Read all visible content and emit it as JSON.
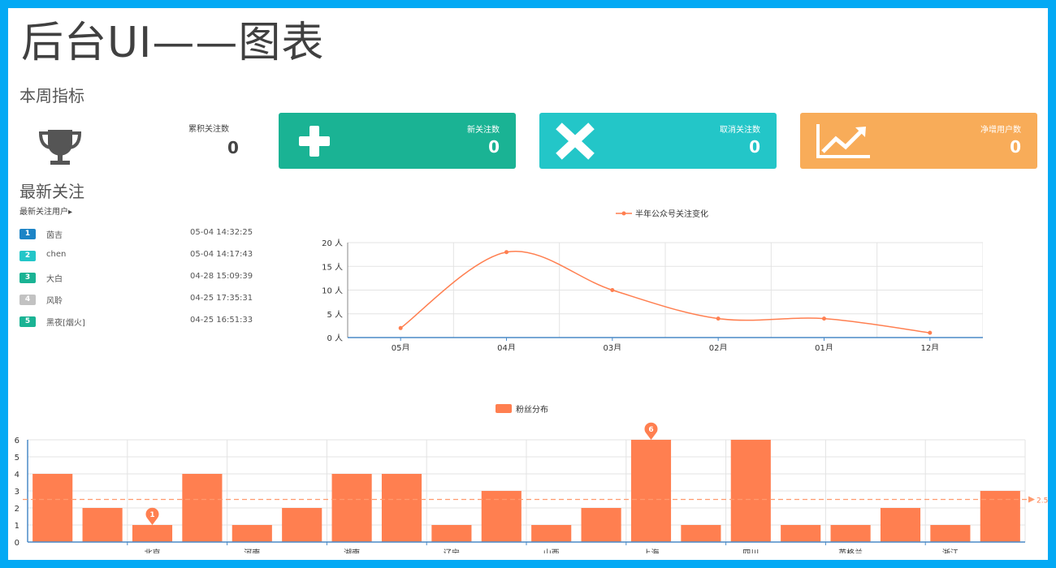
{
  "page": {
    "title": "后台UI——图表"
  },
  "weekly": {
    "title": "本周指标",
    "total": {
      "label": "累积关注数",
      "value": "0",
      "icon": "trophy-icon"
    },
    "cards": [
      {
        "id": "new",
        "label": "新关注数",
        "value": "0",
        "icon": "plus-icon",
        "color": "#1ab394"
      },
      {
        "id": "cancel",
        "label": "取消关注数",
        "value": "0",
        "icon": "cross-icon",
        "color": "#23c6c8"
      },
      {
        "id": "net",
        "label": "净增用户数",
        "value": "0",
        "icon": "trend-up-icon",
        "color": "#f8ac59"
      }
    ]
  },
  "latest": {
    "title": "最新关注",
    "subtitle": "最新关注用户▸",
    "users": [
      {
        "rank": "1",
        "name": "茵吉",
        "time": "05-04 14:32:25",
        "color": "#1c84c6"
      },
      {
        "rank": "2",
        "name": "chen",
        "time": "05-04 14:17:43",
        "color": "#23c6c8"
      },
      {
        "rank": "3",
        "name": "大白",
        "time": "04-28 15:09:39",
        "color": "#1ab394"
      },
      {
        "rank": "4",
        "name": "风聆",
        "time": "04-25 17:35:31",
        "color": "#c2c2c2"
      },
      {
        "rank": "5",
        "name": "黑夜[烟火]",
        "time": "04-25 16:51:33",
        "color": "#1ab394"
      }
    ]
  },
  "chart_data": [
    {
      "type": "line",
      "series": [
        {
          "name": "半年公众号关注变化",
          "values": [
            2,
            18,
            10,
            4,
            4,
            1
          ]
        }
      ],
      "categories": [
        "05月",
        "04月",
        "03月",
        "02月",
        "01月",
        "12月"
      ],
      "yticks": [
        "0 人",
        "5 人",
        "10 人",
        "15 人",
        "20 人"
      ],
      "ylim": [
        0,
        20
      ],
      "color": "#ff7f50",
      "grid": true,
      "legend": "top-center"
    },
    {
      "type": "bar",
      "series": [
        {
          "name": "粉丝分布",
          "values": [
            4,
            2,
            1,
            4,
            1,
            2,
            4,
            4,
            1,
            3,
            1,
            2,
            6,
            1,
            6,
            1,
            1,
            2,
            1,
            3
          ]
        }
      ],
      "xticks": [
        "北京",
        "河南",
        "湖南",
        "辽宁",
        "山西",
        "上海",
        "四川",
        "英格兰",
        "浙江"
      ],
      "yticks": [
        "0",
        "1",
        "2",
        "3",
        "4",
        "5",
        "6"
      ],
      "ylim": [
        0,
        6
      ],
      "mark_min": "1",
      "mark_max": "6",
      "average_line": "2.5",
      "color": "#ff7f50",
      "grid": true,
      "legend": "top-center"
    }
  ]
}
